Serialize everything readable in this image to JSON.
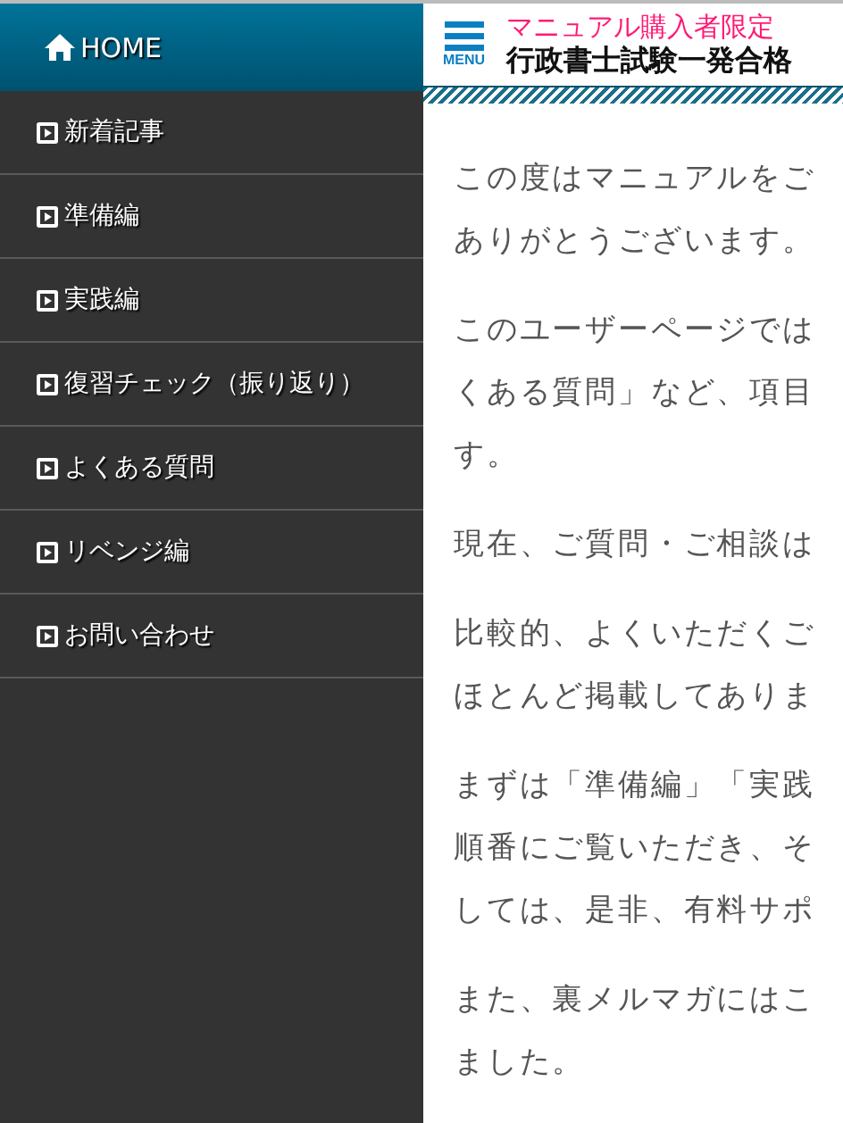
{
  "sidebar": {
    "items": [
      {
        "label": "HOME",
        "kind": "home",
        "selected": true
      },
      {
        "label": "新着記事",
        "kind": "page",
        "selected": false
      },
      {
        "label": "準備編",
        "kind": "page",
        "selected": false
      },
      {
        "label": "実践編",
        "kind": "page",
        "selected": false
      },
      {
        "label": "復習チェック（振り返り）",
        "kind": "page",
        "selected": false
      },
      {
        "label": "よくある質問",
        "kind": "page",
        "selected": false
      },
      {
        "label": "リベンジ編",
        "kind": "page",
        "selected": false
      },
      {
        "label": "お問い合わせ",
        "kind": "page",
        "selected": false
      }
    ]
  },
  "header": {
    "menu_label": "MENU",
    "tagline": "マニュアル購入者限定",
    "title": "行政書士試験一発合格"
  },
  "paragraphs": [
    [
      "この度はマニュアルをご",
      "ありがとうございます。"
    ],
    [
      "このユーザーページでは",
      "くある質問」など、項目",
      "す。"
    ],
    [
      "現在、ご質問・ご相談は"
    ],
    [
      "比較的、よくいただくご",
      "ほとんど掲載してありま"
    ],
    [
      "まずは「準備編」「実践",
      "順番にご覧いただき、そ",
      "しては、是非、有料サポ"
    ],
    [
      "また、裏メルマガにはこ",
      "ました。"
    ]
  ]
}
